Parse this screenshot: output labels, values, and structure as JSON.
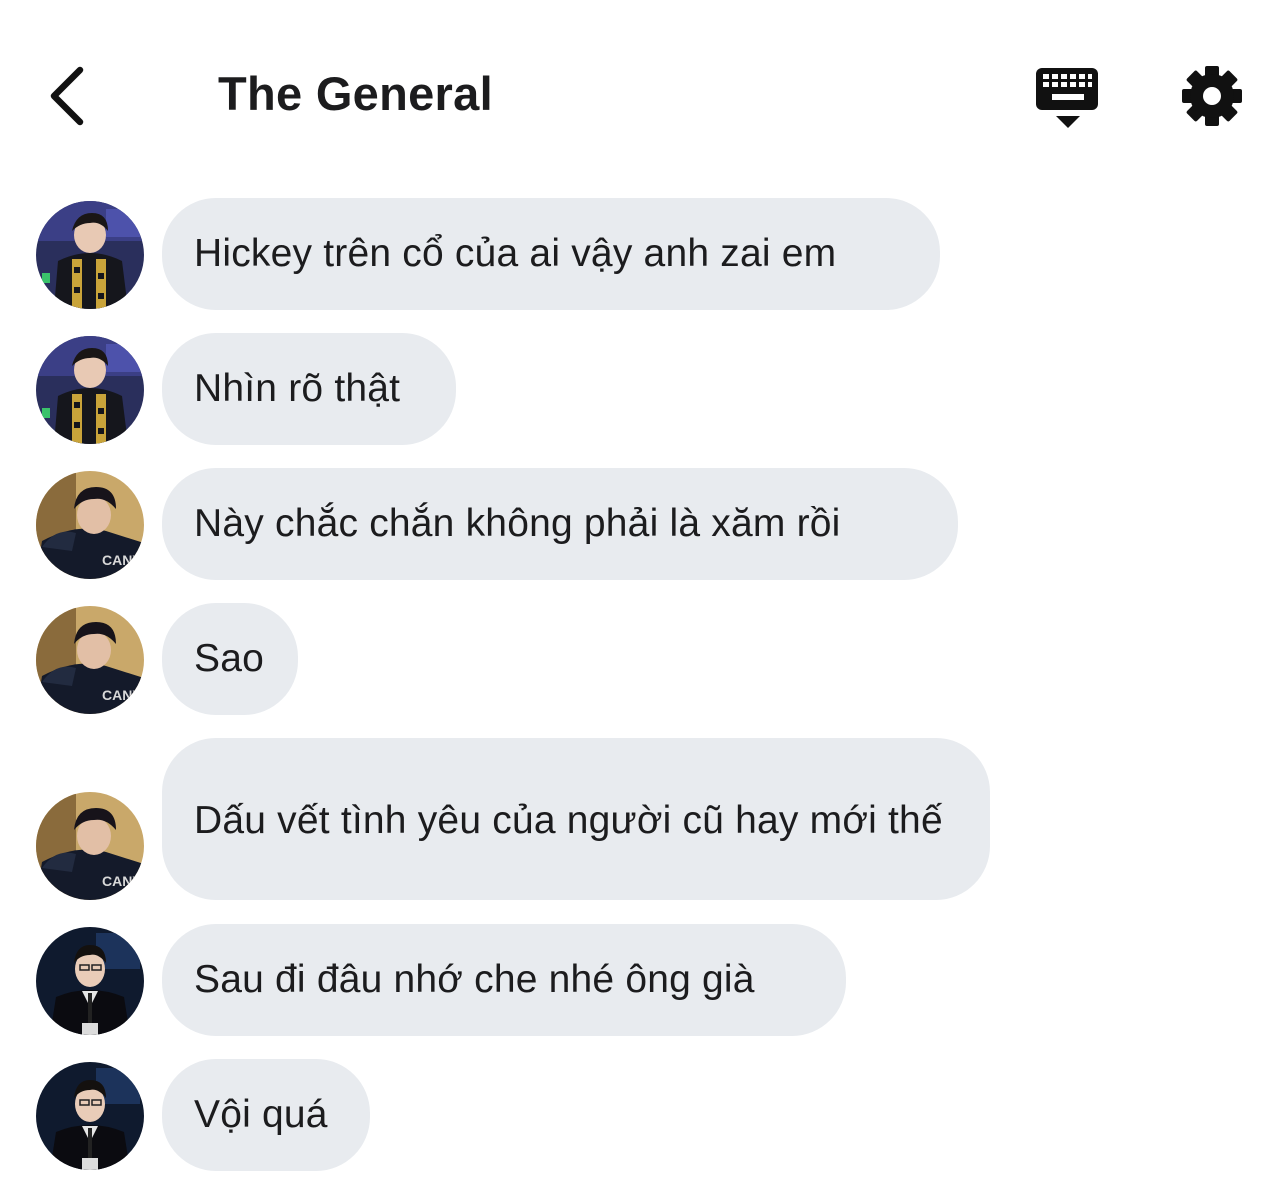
{
  "header": {
    "back_icon": "chevron-left-icon",
    "title": "The General",
    "keyboard_icon": "keyboard-icon",
    "settings_icon": "gear-icon"
  },
  "messages": [
    {
      "sender": "user-a",
      "text": "Hickey trên cổ của ai vậy anh zai em"
    },
    {
      "sender": "user-a",
      "text": "Nhìn rõ thật"
    },
    {
      "sender": "user-b",
      "text": "Này chắc chắn không phải là xăm rồi"
    },
    {
      "sender": "user-b",
      "text": "Sao"
    },
    {
      "sender": "user-b",
      "text": "Dấu vết tình yêu của người cũ hay mới thế"
    },
    {
      "sender": "user-c",
      "text": "Sau đi đâu nhớ che nhé ông già"
    },
    {
      "sender": "user-c",
      "text": "Vội quá"
    }
  ],
  "colors": {
    "bubble": "#e8ebef",
    "text": "#1c1c1e",
    "background": "#ffffff"
  }
}
